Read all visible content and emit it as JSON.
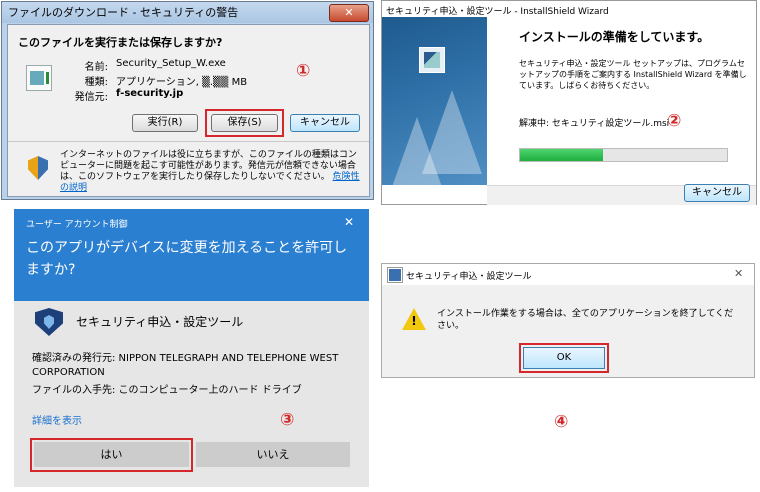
{
  "panel1": {
    "title": "ファイルのダウンロード - セキュリティの警告",
    "close_glyph": "✕",
    "question": "このファイルを実行または保存しますか?",
    "fields": [
      {
        "label": "名前:",
        "value": "Security_Setup_W.exe"
      },
      {
        "label": "種類:",
        "value": "アプリケーション, ▒.▒▒ MB"
      },
      {
        "label": "発信元:",
        "value": "f-security.jp"
      }
    ],
    "buttons": {
      "run": "実行(R)",
      "save": "保存(S)",
      "cancel": "キャンセル"
    },
    "warning_text": "インターネットのファイルは役に立ちますが、このファイルの種類はコンピューターに問題を起こす可能性があります。発信元が信頼できない場合は、このソフトウェアを実行したり保存したりしないでください。",
    "warning_link": "危険性の説明",
    "step_number": "①"
  },
  "panel2": {
    "title": "セキュリティ申込・設定ツール - InstallShield Wizard",
    "heading": "インストールの準備をしています。",
    "description": "セキュリティ申込・設定ツール セットアップは、プログラムセットアップの手順をご案内する InstallShield Wizard を準備しています。しばらくお待ちください。",
    "status": "解凍中: セキュリティ設定ツール.msi",
    "progress_fraction": 0.4,
    "cancel_button": "キャンセル",
    "step_number": "②"
  },
  "panel3": {
    "caption": "ユーザー アカウント制御",
    "close_glyph": "✕",
    "question": "このアプリがデバイスに変更を加えることを許可しますか?",
    "app_name": "セキュリティ申込・設定ツール",
    "publisher": "確認済みの発行元: NIPPON TELEGRAPH AND TELEPHONE WEST CORPORATION",
    "origin": "ファイルの入手先: このコンピューター上のハード ドライブ",
    "details_link": "詳細を表示",
    "yes_button": "はい",
    "no_button": "いいえ",
    "step_number": "③"
  },
  "panel4": {
    "title": "セキュリティ申込・設定ツール",
    "close_glyph": "✕",
    "warning_glyph": "!",
    "message": "インストール作業をする場合は、全てのアプリケーションを終了してください。",
    "ok_button": "OK",
    "step_number": "④"
  },
  "colors": {
    "highlight_red": "#d4282c",
    "step_number_red": "#d12a2a",
    "uac_blue": "#2b7fd1",
    "progress_green": "#1fae3f"
  }
}
